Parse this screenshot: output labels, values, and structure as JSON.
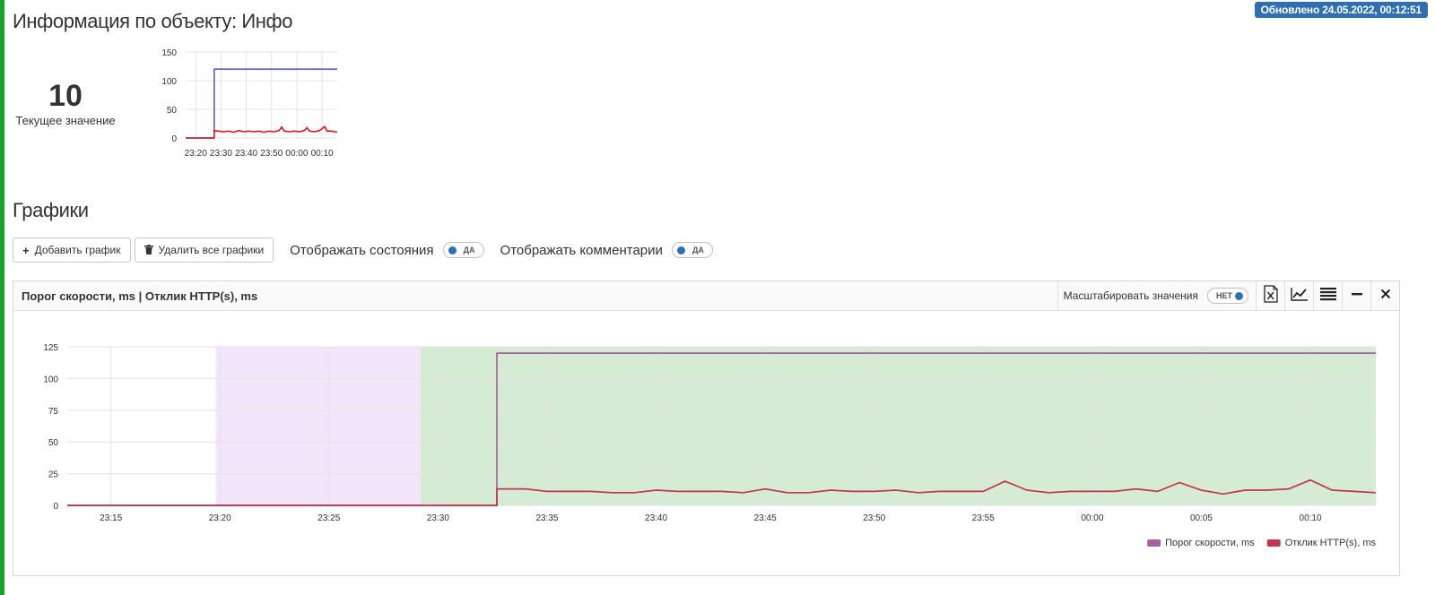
{
  "header": {
    "updated_badge": "Обновлено 24.05.2022, 00:12:51",
    "page_title": "Информация по объекту: Инфо"
  },
  "current": {
    "value": "10",
    "label": "Текущее значение"
  },
  "section": {
    "title": "Графики"
  },
  "toolbar": {
    "add_label": "Добавить график",
    "add_icon": "plus-icon",
    "delete_label": "Удалить все графики",
    "delete_icon": "trash-icon",
    "states_label": "Отображать состояния",
    "states_toggle": "ДА",
    "comments_label": "Отображать комментарии",
    "comments_toggle": "ДА"
  },
  "panel": {
    "title": "Порог скорости, ms | Отклик HTTP(s), ms",
    "scale_label": "Масштабировать значения",
    "scale_toggle": "НЕТ",
    "icons": [
      "excel-export-icon",
      "line-chart-icon",
      "list-icon",
      "minimize-icon",
      "close-icon"
    ]
  },
  "colors": {
    "badge": "#2f6fb0",
    "threshold": "#a0659c",
    "response": "#c0364e",
    "band_purple": "#f3e6fb",
    "band_green": "#d6ebd4",
    "spark_threshold": "#5b62a6",
    "spark_response": "#d8131f"
  },
  "chart_data": [
    {
      "type": "line",
      "x_ticks": [
        "23:20",
        "23:30",
        "23:40",
        "23:50",
        "00:00",
        "00:10"
      ],
      "y_ticks": [
        0,
        50,
        100,
        150
      ],
      "ylim": [
        0,
        150
      ],
      "xlim_minutes": [
        -44,
        16
      ],
      "series": [
        {
          "color": "#5b62a6",
          "points": [
            [
              -44,
              0
            ],
            [
              -32.7,
              0
            ],
            [
              -32.7,
              120
            ],
            [
              16,
              120
            ]
          ]
        },
        {
          "color": "#d8131f",
          "points": [
            [
              -44,
              0
            ],
            [
              -32.7,
              0
            ],
            [
              -32.7,
              13
            ],
            [
              -31,
              12
            ],
            [
              -29,
              11
            ],
            [
              -27,
              12
            ],
            [
              -25,
              10
            ],
            [
              -23,
              13
            ],
            [
              -21,
              11
            ],
            [
              -19,
              12
            ],
            [
              -17,
              11
            ],
            [
              -15,
              12
            ],
            [
              -13,
              10
            ],
            [
              -11,
              12
            ],
            [
              -9,
              11
            ],
            [
              -7,
              13
            ],
            [
              -6,
              19
            ],
            [
              -5,
              12
            ],
            [
              -3,
              11
            ],
            [
              -1,
              12
            ],
            [
              1,
              11
            ],
            [
              3,
              13
            ],
            [
              4,
              18
            ],
            [
              5,
              12
            ],
            [
              7,
              11
            ],
            [
              9,
              13
            ],
            [
              11,
              20
            ],
            [
              12,
              12
            ],
            [
              14,
              12
            ],
            [
              16,
              10
            ]
          ]
        }
      ],
      "grid": true
    },
    {
      "type": "line",
      "x_ticks": [
        "23:15",
        "23:20",
        "23:25",
        "23:30",
        "23:35",
        "23:40",
        "23:45",
        "23:50",
        "23:55",
        "00:00",
        "00:05",
        "00:10"
      ],
      "y_ticks": [
        0,
        25,
        50,
        75,
        100,
        125
      ],
      "ylim": [
        0,
        125
      ],
      "xlim_minutes": [
        -47,
        13
      ],
      "bands": [
        {
          "from": -40.2,
          "to": -30.8,
          "color": "#f3e6fb"
        },
        {
          "from": -30.8,
          "to": 13,
          "color": "#d6ebd4"
        }
      ],
      "series": [
        {
          "name": "Порог скорости, ms",
          "color": "#a0659c",
          "points": [
            [
              -47,
              0
            ],
            [
              -27.3,
              0
            ],
            [
              -27.3,
              120
            ],
            [
              13,
              120
            ]
          ]
        },
        {
          "name": "Отклик HTTP(s), ms",
          "color": "#c0364e",
          "points": [
            [
              -47,
              0
            ],
            [
              -27.3,
              0
            ],
            [
              -27.3,
              13
            ],
            [
              -26,
              13
            ],
            [
              -25,
              11
            ],
            [
              -24,
              11
            ],
            [
              -23,
              11
            ],
            [
              -22,
              10
            ],
            [
              -21,
              10
            ],
            [
              -20,
              12
            ],
            [
              -19,
              11
            ],
            [
              -18,
              11
            ],
            [
              -17,
              11
            ],
            [
              -16,
              10
            ],
            [
              -15,
              13
            ],
            [
              -14,
              10
            ],
            [
              -13,
              10
            ],
            [
              -12,
              12
            ],
            [
              -11,
              11
            ],
            [
              -10,
              11
            ],
            [
              -9,
              12
            ],
            [
              -8,
              10
            ],
            [
              -7,
              11
            ],
            [
              -6,
              11
            ],
            [
              -5,
              11
            ],
            [
              -4,
              19
            ],
            [
              -3,
              12
            ],
            [
              -2,
              10
            ],
            [
              -1,
              11
            ],
            [
              0,
              11
            ],
            [
              1,
              11
            ],
            [
              2,
              13
            ],
            [
              3,
              11
            ],
            [
              4,
              18
            ],
            [
              5,
              12
            ],
            [
              6,
              9
            ],
            [
              7,
              12
            ],
            [
              8,
              12
            ],
            [
              9,
              13
            ],
            [
              10,
              20
            ],
            [
              11,
              12
            ],
            [
              12,
              11
            ],
            [
              13,
              10
            ]
          ]
        }
      ],
      "legend": "bottom-right",
      "grid": true
    }
  ]
}
